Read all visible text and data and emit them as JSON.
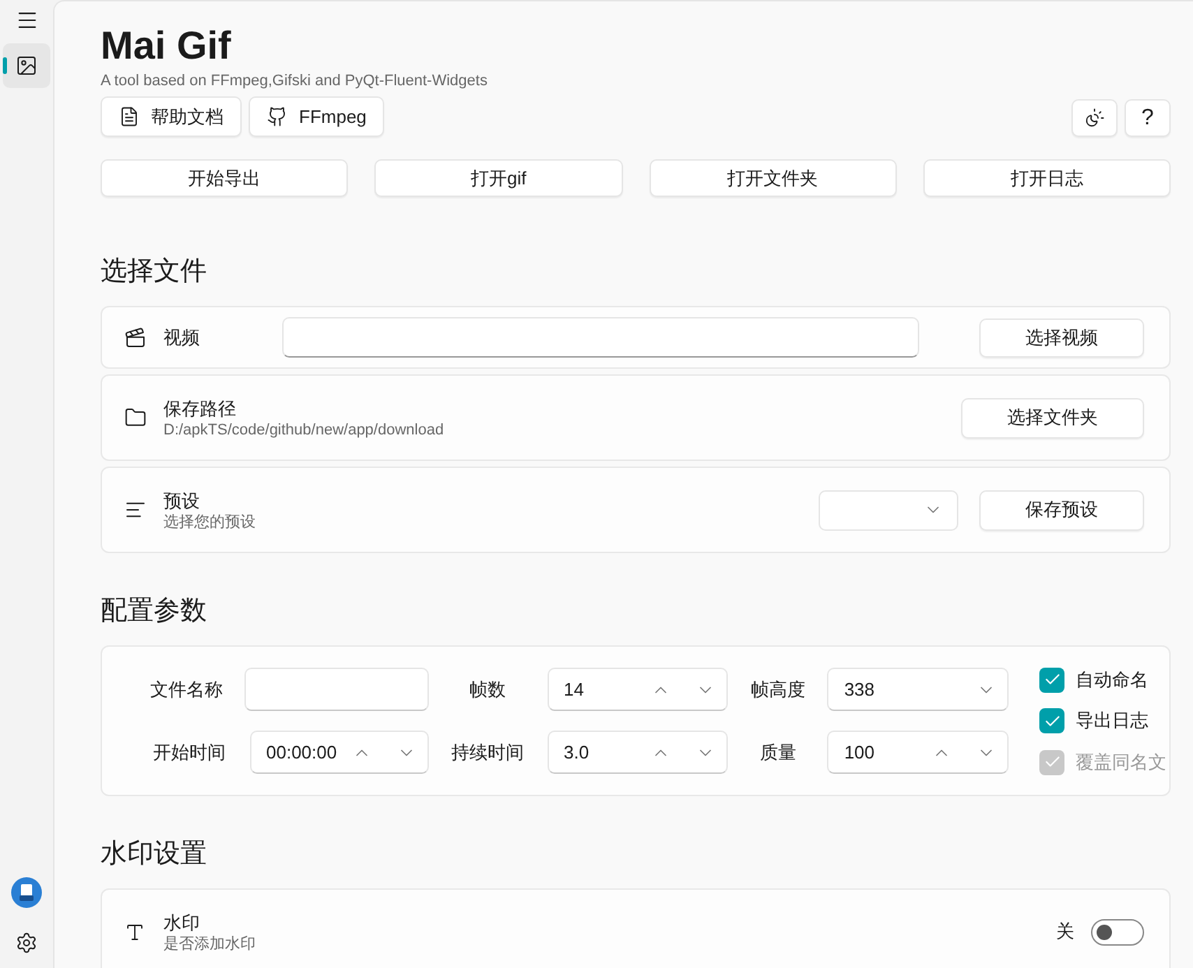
{
  "nav": {
    "items": [
      {
        "kind": "image",
        "selected": true
      }
    ],
    "bottom": [
      {
        "kind": "avatar"
      },
      {
        "kind": "settings"
      }
    ]
  },
  "header": {
    "title": "Mai Gif",
    "subtitle": "A tool based on FFmpeg,Gifski and PyQt-Fluent-Widgets",
    "links": [
      {
        "label": "帮助文档",
        "kind": "doc"
      },
      {
        "label": "FFmpeg",
        "kind": "github"
      }
    ],
    "tools": [
      {
        "kind": "theme"
      },
      {
        "kind": "help",
        "label": "?"
      }
    ]
  },
  "actions": [
    "开始导出",
    "打开gif",
    "打开文件夹",
    "打开日志"
  ],
  "file_section": {
    "heading": "选择文件",
    "video": {
      "label": "视频",
      "button": "选择视频"
    },
    "save_path": {
      "label": "保存路径",
      "path": "D:/apkTS/code/github/new/app/download",
      "button": "选择文件夹"
    },
    "preset": {
      "label": "预设",
      "hint": "选择您的预设",
      "button": "保存预设"
    }
  },
  "config_section": {
    "heading": "配置参数",
    "fields": [
      {
        "label": "文件名称",
        "kind": "text"
      },
      {
        "label": "帧数",
        "kind": "spin",
        "value": "14"
      },
      {
        "label": "帧高度",
        "kind": "combo",
        "value": "338"
      },
      {
        "label": "开始时间",
        "kind": "spin",
        "value": "00:00:00"
      },
      {
        "label": "持续时间",
        "kind": "spin",
        "value": "3.0"
      },
      {
        "label": "质量",
        "kind": "spin",
        "value": "100"
      }
    ],
    "checkboxes": [
      {
        "label": "自动命名",
        "checked": true,
        "disabled": false
      },
      {
        "label": "导出日志",
        "checked": true,
        "disabled": false
      },
      {
        "label": "覆盖同名文",
        "checked": true,
        "disabled": true
      }
    ]
  },
  "watermark_section": {
    "heading": "水印设置",
    "title": "水印",
    "hint": "是否添加水印",
    "state_label": "关",
    "on": false
  }
}
